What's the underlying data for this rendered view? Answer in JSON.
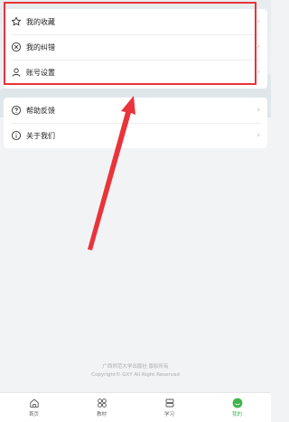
{
  "menu_group_1": [
    {
      "label": "我的收藏",
      "icon": "star-icon"
    },
    {
      "label": "我的纠错",
      "icon": "correction-icon"
    },
    {
      "label": "账号设置",
      "icon": "user-icon"
    }
  ],
  "menu_group_2": [
    {
      "label": "帮助反馈",
      "icon": "help-icon"
    },
    {
      "label": "关于我们",
      "icon": "info-icon"
    }
  ],
  "chevron": "›",
  "footer": {
    "line1": "广西师范大学出版社 版权所有",
    "line2": "Copyright© GXY All Right Reserved"
  },
  "tabs": [
    {
      "label": "首页",
      "icon": "home-icon"
    },
    {
      "label": "教材",
      "icon": "grid-icon"
    },
    {
      "label": "学习",
      "icon": "learn-icon"
    },
    {
      "label": "我的",
      "icon": "profile-icon"
    }
  ],
  "colors": {
    "accent": "#3fb34f",
    "annotation": "#e8343a"
  }
}
